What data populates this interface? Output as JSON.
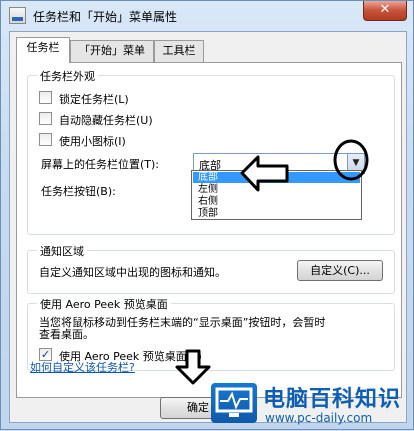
{
  "window": {
    "title": "任务栏和「开始」菜单属性",
    "close_glyph": "✕"
  },
  "tabs": [
    {
      "label": "任务栏",
      "active": true
    },
    {
      "label": "「开始」菜单",
      "active": false
    },
    {
      "label": "工具栏",
      "active": false
    }
  ],
  "appearance": {
    "group_title": "任务栏外观",
    "options": [
      {
        "label": "锁定任务栏(L)",
        "checked": false
      },
      {
        "label": "自动隐藏任务栏(U)",
        "checked": false
      },
      {
        "label": "使用小图标(I)",
        "checked": false
      }
    ],
    "position_label": "屏幕上的任务栏位置(T):",
    "position_value": "底部",
    "position_options": [
      "底部",
      "左侧",
      "右侧",
      "顶部"
    ],
    "buttons_label": "任务栏按钮(B):"
  },
  "notification": {
    "group_title": "通知区域",
    "description": "自定义通知区域中出现的图标和通知。",
    "customize_button": "自定义(C)..."
  },
  "aero_peek": {
    "group_title": "使用 Aero Peek 预览桌面",
    "description_line1": "当您将鼠标移动到任务栏末端的“显示桌面”按钮时，会暂时",
    "description_line2": "查看桌面。",
    "checkbox_label": "使用 Aero Peek 预览桌面(P)",
    "checked": true
  },
  "help_link": "如何自定义该任务栏?",
  "ok_button": "确定",
  "watermark": {
    "title": "电脑百科知识",
    "url": "www.pc-daily.com"
  },
  "colors": {
    "selection": "#3399ff",
    "link": "#0a56b0",
    "annotation": "#000000"
  }
}
